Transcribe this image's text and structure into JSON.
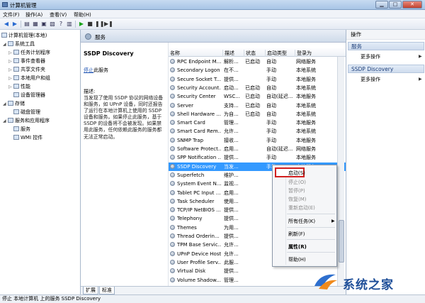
{
  "window": {
    "title": "计算机管理",
    "controls": {
      "minimize": "▁",
      "maximize": "□",
      "close": "✕"
    }
  },
  "menu": [
    "文件(F)",
    "操作(A)",
    "查看(V)",
    "帮助(H)"
  ],
  "toolbar": {
    "icons": [
      "back-icon",
      "forward-icon",
      "up-folder-icon",
      "show-tree-icon",
      "properties-icon",
      "export-icon",
      "help-icon",
      "refresh-icon",
      "start-icon",
      "stop-icon",
      "pause-icon",
      "restart-icon"
    ]
  },
  "tree": {
    "root": "计算机管理(本地)",
    "items": [
      "系统工具",
      "任务计划程序",
      "事件查看器",
      "共享文件夹",
      "本地用户和组",
      "性能",
      "设备管理器",
      "存储",
      "磁盘管理",
      "服务和应用程序",
      "服务",
      "WMI 控件"
    ]
  },
  "center": {
    "header": "服务",
    "service_title": "SSDP Discovery",
    "stop_link": "停止",
    "stop_suffix": "此服务",
    "desc_label": "描述:",
    "description": "当发现了使用 SSDP 协议的网络设备和服务，如 UPnP 设备，同时还报告了运行在本地计算机上使用的 SSDP 设备和服务。如果停止此服务，基于 SSDP 的设备将不会被发现。如果禁用此服务，任何依赖此服务的服务都无法正常启动。",
    "columns": [
      "名称",
      "描述",
      "状态",
      "启动类型",
      "登录为"
    ],
    "rows": [
      {
        "name": "RPC Endpoint M...",
        "desc": "解析...",
        "status": "已启动",
        "startup": "自动",
        "logon": "网络服务"
      },
      {
        "name": "Secondary Logon",
        "desc": "在不...",
        "status": "",
        "startup": "手动",
        "logon": "本地系统"
      },
      {
        "name": "Secure Socket T...",
        "desc": "提供...",
        "status": "",
        "startup": "手动",
        "logon": "本地服务"
      },
      {
        "name": "Security Account...",
        "desc": "启动...",
        "status": "已启动",
        "startup": "自动",
        "logon": "本地系统"
      },
      {
        "name": "Security Center",
        "desc": "WSC...",
        "status": "已启动",
        "startup": "自动(延迟...",
        "logon": "本地服务"
      },
      {
        "name": "Server",
        "desc": "支持...",
        "status": "已启动",
        "startup": "自动",
        "logon": "本地系统"
      },
      {
        "name": "Shell Hardware ...",
        "desc": "为自...",
        "status": "已启动",
        "startup": "自动",
        "logon": "本地系统"
      },
      {
        "name": "Smart Card",
        "desc": "管理...",
        "status": "",
        "startup": "手动",
        "logon": "本地服务"
      },
      {
        "name": "Smart Card Rem...",
        "desc": "允许...",
        "status": "",
        "startup": "手动",
        "logon": "本地系统"
      },
      {
        "name": "SNMP Trap",
        "desc": "接收...",
        "status": "",
        "startup": "手动",
        "logon": "本地服务"
      },
      {
        "name": "Software Protect...",
        "desc": "启用...",
        "status": "",
        "startup": "自动(延迟...",
        "logon": "网络服务"
      },
      {
        "name": "SPP Notification ...",
        "desc": "提供...",
        "status": "",
        "startup": "手动",
        "logon": "本地服务"
      },
      {
        "name": "SSDP Discovery",
        "desc": "当发...",
        "status": "",
        "startup": "手动",
        "logon": "本地服务"
      },
      {
        "name": "Superfetch",
        "desc": "维护...",
        "status": "",
        "startup": "",
        "logon": ""
      },
      {
        "name": "System Event N...",
        "desc": "监视...",
        "status": "",
        "startup": "",
        "logon": ""
      },
      {
        "name": "Tablet PC Input ...",
        "desc": "启用...",
        "status": "",
        "startup": "",
        "logon": ""
      },
      {
        "name": "Task Scheduler",
        "desc": "使用...",
        "status": "",
        "startup": "",
        "logon": ""
      },
      {
        "name": "TCP/IP NetBIOS ...",
        "desc": "提供...",
        "status": "",
        "startup": "",
        "logon": ""
      },
      {
        "name": "Telephony",
        "desc": "提供...",
        "status": "",
        "startup": "",
        "logon": ""
      },
      {
        "name": "Themes",
        "desc": "为用...",
        "status": "",
        "startup": "",
        "logon": ""
      },
      {
        "name": "Thread Orderin...",
        "desc": "提供...",
        "status": "",
        "startup": "",
        "logon": ""
      },
      {
        "name": "TPM Base Servic...",
        "desc": "允许...",
        "status": "",
        "startup": "",
        "logon": ""
      },
      {
        "name": "UPnP Device Host",
        "desc": "允许...",
        "status": "",
        "startup": "",
        "logon": ""
      },
      {
        "name": "User Profile Serv...",
        "desc": "此服...",
        "status": "",
        "startup": "",
        "logon": ""
      },
      {
        "name": "Virtual Disk",
        "desc": "提供...",
        "status": "",
        "startup": "",
        "logon": ""
      },
      {
        "name": "Volume Shadow...",
        "desc": "管理...",
        "status": "",
        "startup": "",
        "logon": ""
      }
    ],
    "tabs": [
      "扩展",
      "标准"
    ]
  },
  "context_menu": {
    "start": "启动(S)",
    "stop": "停止(O)",
    "pause": "暂停(P)",
    "resume": "恢复(M)",
    "restart": "重新启动(E)",
    "all_tasks": "所有任务(K)",
    "refresh": "刷新(F)",
    "properties": "属性(R)",
    "help": "帮助(H)"
  },
  "actions": {
    "title": "操作",
    "section1": "服务",
    "more1": "更多操作",
    "section2": "SSDP Discovery",
    "more2": "更多操作"
  },
  "statusbar": "停止 本地计算机 上的服务 SSDP Discovery",
  "watermark": {
    "text": "系统之家"
  }
}
